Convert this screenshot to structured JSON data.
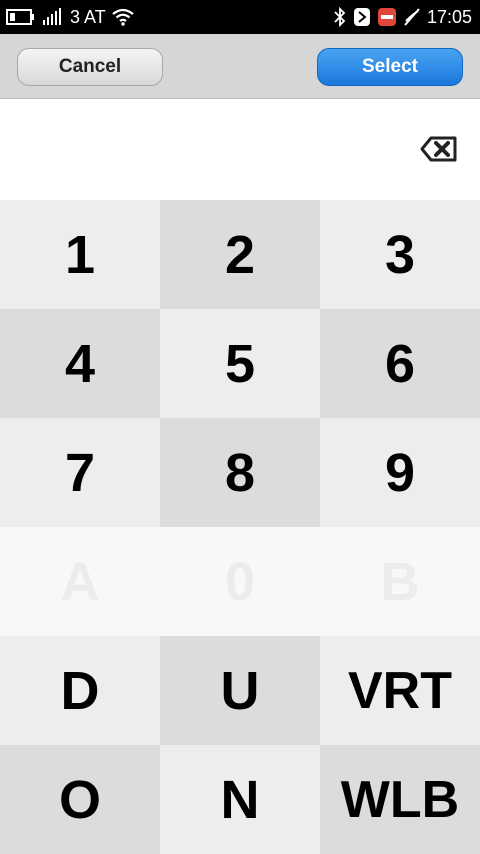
{
  "status_bar": {
    "carrier": "3 AT",
    "time": "17:05",
    "icons": [
      "battery-icon",
      "signal-icon",
      "wifi-icon",
      "bluetooth-icon",
      "nfc-icon",
      "do-not-disturb-icon",
      "offline-icon"
    ]
  },
  "toolbar": {
    "cancel_label": "Cancel",
    "select_label": "Select"
  },
  "input": {
    "value": ""
  },
  "colors": {
    "toolbar_bg": "#d6d6d6",
    "select_blue": "#1a78dd",
    "key_light": "#ededed",
    "key_dark": "#dcdcdc",
    "key_disabled_text": "#ececec",
    "status_bar_bg": "#000000"
  },
  "keypad": {
    "keys": [
      "1",
      "2",
      "3",
      "4",
      "5",
      "6",
      "7",
      "8",
      "9",
      "A",
      "0",
      "B",
      "D",
      "U",
      "VRT",
      "O",
      "N",
      "WLB"
    ],
    "disabled": [
      "A",
      "0",
      "B"
    ]
  }
}
